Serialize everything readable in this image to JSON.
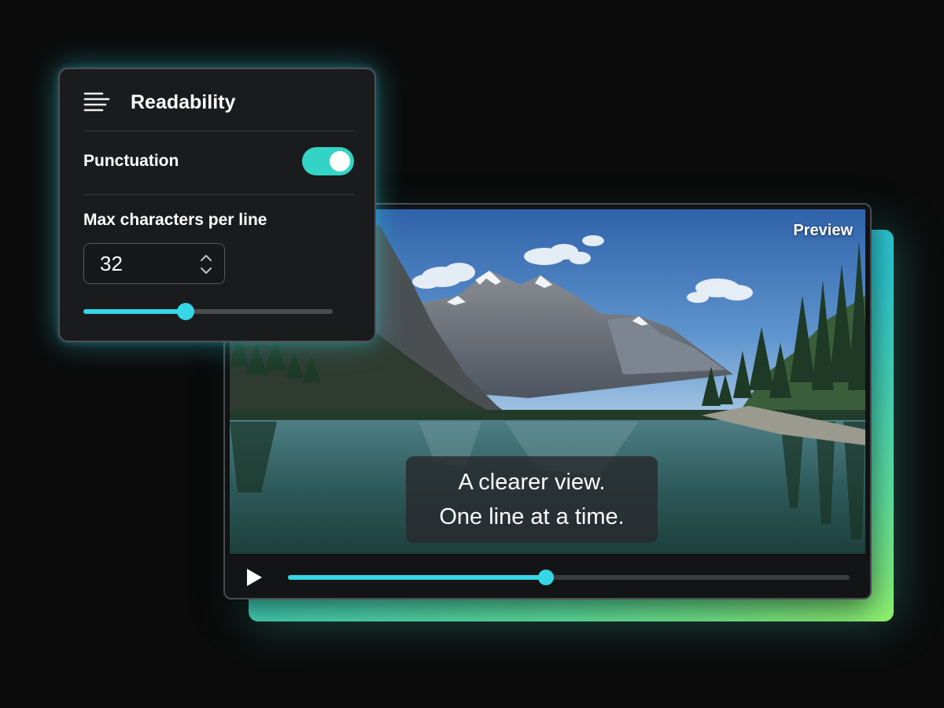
{
  "panel": {
    "title": "Readability",
    "icon": "text-align-left-icon",
    "punctuation": {
      "label": "Punctuation",
      "enabled": true
    },
    "max_chars": {
      "label": "Max characters per line",
      "value": "32",
      "slider_fraction": 0.41
    }
  },
  "player": {
    "preview_label": "Preview",
    "caption": {
      "line1": "A clearer view.",
      "line2": "One line at a time."
    },
    "play_icon": "play-icon",
    "progress_fraction": 0.46
  },
  "colors": {
    "accent": "#35d6e6",
    "toggle_on": "#33d4c6",
    "gradient_start": "#27c3f0",
    "gradient_end": "#8ff26d",
    "background": "#0b0b0b"
  }
}
